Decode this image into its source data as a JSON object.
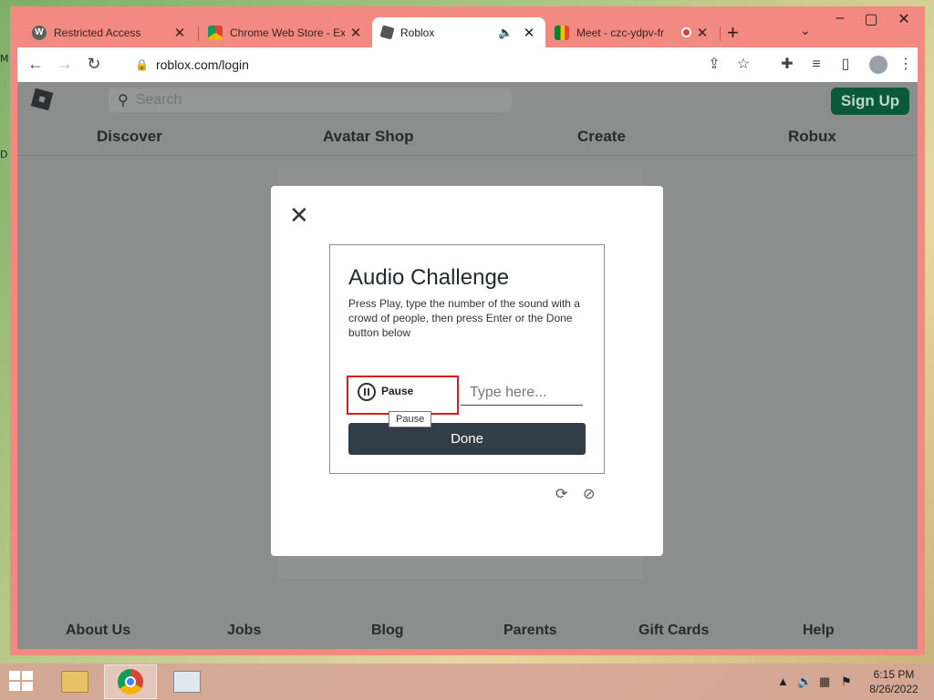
{
  "desktop": {
    "frag_top": "M",
    "frag_mid": "D"
  },
  "browser": {
    "tabs": [
      {
        "title": "Restricted Access",
        "favicon": "W"
      },
      {
        "title": "Chrome Web Store - Ex",
        "favicon": ""
      },
      {
        "title": "Roblox",
        "favicon": ""
      },
      {
        "title": "Meet - czc-ydpv-fr",
        "favicon": ""
      }
    ],
    "url": "roblox.com/login"
  },
  "roblox": {
    "search_placeholder": "Search",
    "signup": "Sign Up",
    "nav": [
      "Discover",
      "Avatar Shop",
      "Create",
      "Robux"
    ],
    "footer": [
      "About Us",
      "Jobs",
      "Blog",
      "Parents",
      "Gift Cards",
      "Help"
    ]
  },
  "challenge": {
    "title": "Audio Challenge",
    "description": "Press Play, type the number of the sound with a crowd of people, then press Enter or the Done button below",
    "pause_label": "Pause",
    "tooltip": "Pause",
    "input_placeholder": "Type here...",
    "done_label": "Done"
  },
  "taskbar": {
    "time": "6:15 PM",
    "date": "8/26/2022"
  }
}
